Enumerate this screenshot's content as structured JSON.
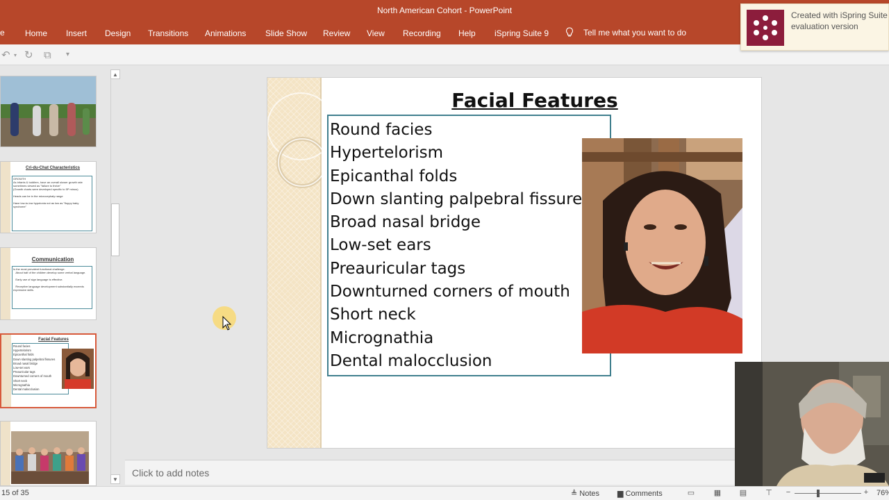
{
  "app": {
    "title": "North American Cohort  -  PowerPoint",
    "file_tab": "e"
  },
  "menu": [
    {
      "label": "Home"
    },
    {
      "label": "Insert"
    },
    {
      "label": "Design"
    },
    {
      "label": "Transitions"
    },
    {
      "label": "Animations"
    },
    {
      "label": "Slide Show"
    },
    {
      "label": "Review"
    },
    {
      "label": "View"
    },
    {
      "label": "Recording"
    },
    {
      "label": "Help"
    },
    {
      "label": "iSpring Suite 9"
    }
  ],
  "tell_me": "Tell me what you want to do",
  "ispring_banner": {
    "line1": "Created with iSpring Suite",
    "line2": "evaluation version"
  },
  "thumbnails": [
    {
      "kind": "photo",
      "title": ""
    },
    {
      "kind": "text",
      "title": "Cri-du-Chat Characteristics",
      "body": "GROWTH\nAs infants & toddlers, have an overall slower growth rate sometimes viewed as \"failure to thrive\"\n(Growth charts were developed specific to 5P minus)\n\nHeads can be in the microcephaly range\n\nHave low-to-low hypotonia not as low as \"floppy baby syndrome\""
    },
    {
      "kind": "text",
      "title": "Communication",
      "body": "Is the most prevalent functional challenge.\n   About half of the children develop some verbal language.\n\n   Early use of sign language is effective.\n\n   Receptive language development substantially exceeds expressive skills."
    },
    {
      "kind": "selected",
      "title": "Facial Features"
    },
    {
      "kind": "photo",
      "title": ""
    }
  ],
  "slide": {
    "title": "Facial Features",
    "features": [
      "Round facies",
      "Hypertelorism",
      "Epicanthal folds",
      "Down slanting palpebral fissures",
      "Broad nasal bridge",
      "Low-set ears",
      "Preauricular tags",
      "Downturned corners of mouth",
      "Short neck",
      "Micrognathia",
      "Dental malocclusion"
    ]
  },
  "notes_placeholder": "Click to add notes",
  "status": {
    "slide_count": "15 of 35",
    "notes_label": "Notes",
    "comments_label": "Comments",
    "zoom": "76%"
  },
  "colors": {
    "ribbon": "#b7472a",
    "selection": "#d7593a",
    "box_border": "#3f7e8d",
    "ispring_logo": "#8c1d3c"
  }
}
